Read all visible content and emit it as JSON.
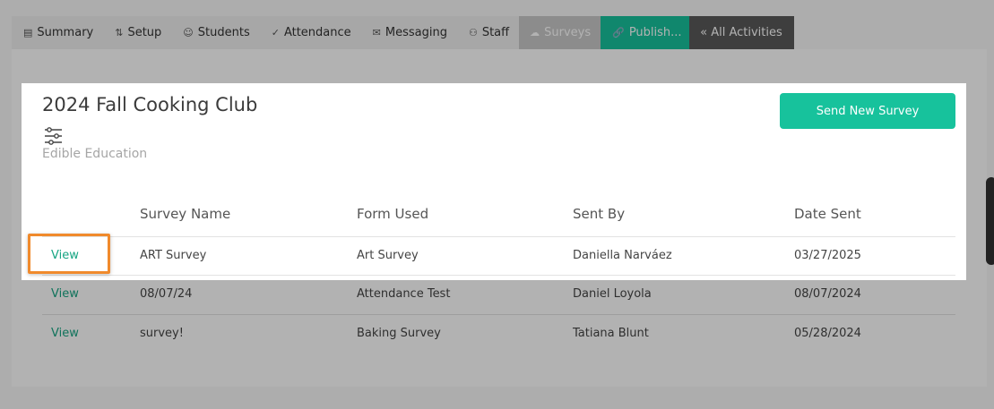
{
  "tabs": [
    {
      "label": "Summary",
      "icon": "chart-icon"
    },
    {
      "label": "Setup",
      "icon": "sliders-icon"
    },
    {
      "label": "Students",
      "icon": "students-icon"
    },
    {
      "label": "Attendance",
      "icon": "check-icon"
    },
    {
      "label": "Messaging",
      "icon": "envelope-icon"
    },
    {
      "label": "Staff",
      "icon": "staff-icon"
    },
    {
      "label": "Surveys",
      "icon": "cloud-icon"
    },
    {
      "label": "Publish...",
      "icon": "link-icon"
    },
    {
      "label": "« All Activities"
    }
  ],
  "header": {
    "title": "2024 Fall Cooking Club",
    "subtitle": "Edible Education",
    "send_button": "Send New Survey"
  },
  "table": {
    "columns": [
      "Survey Name",
      "Form Used",
      "Sent By",
      "Date Sent"
    ],
    "rows": [
      {
        "action": "View",
        "survey_name": "ART Survey",
        "form_used": "Art Survey",
        "sent_by": "Daniella Narváez",
        "date_sent": "03/27/2025"
      },
      {
        "action": "View",
        "survey_name": "08/07/24",
        "form_used": "Attendance Test",
        "sent_by": "Daniel Loyola",
        "date_sent": "08/07/2024"
      },
      {
        "action": "View",
        "survey_name": "survey!",
        "form_used": "Baking Survey",
        "sent_by": "Tatiana Blunt",
        "date_sent": "05/28/2024"
      }
    ]
  },
  "colors": {
    "accent": "#17c29c",
    "highlight_border": "#f08a2c",
    "link": "#17a583"
  }
}
